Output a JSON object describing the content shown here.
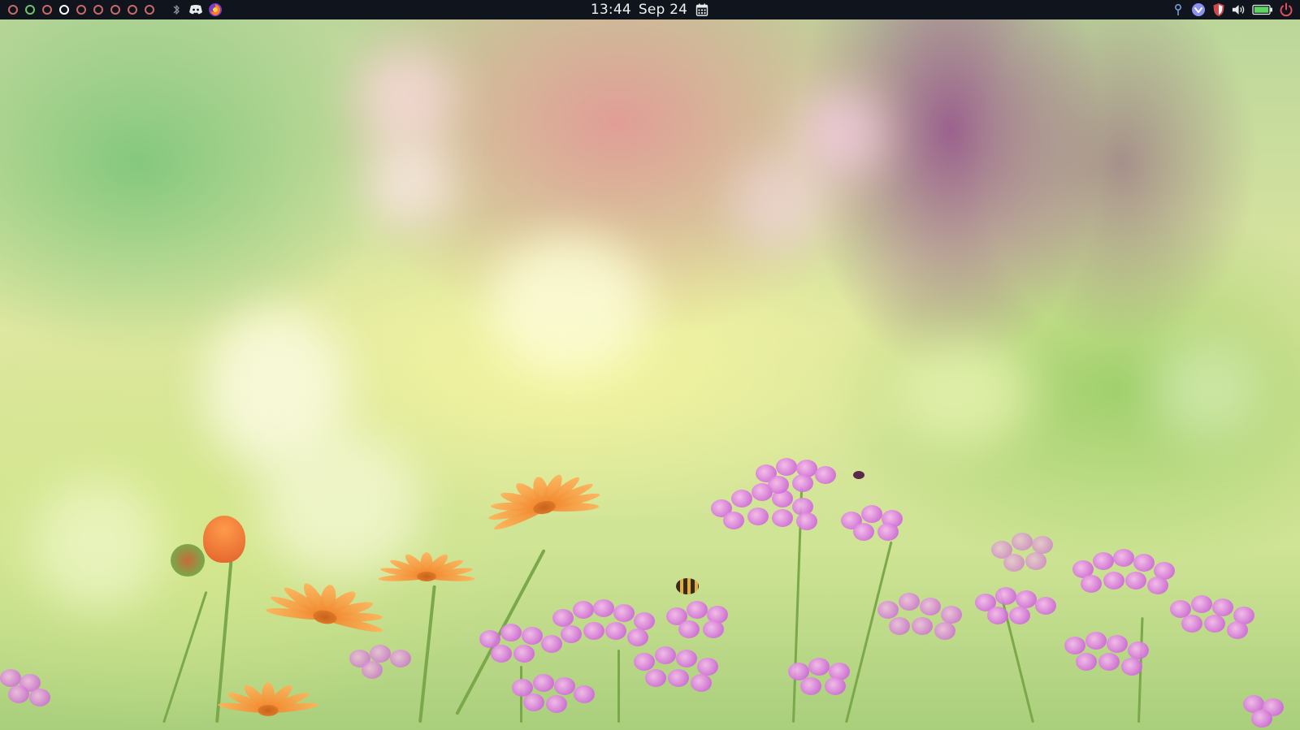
{
  "panel": {
    "workspaces": [
      {
        "state": "empty"
      },
      {
        "state": "occupied"
      },
      {
        "state": "empty"
      },
      {
        "state": "active"
      },
      {
        "state": "empty"
      },
      {
        "state": "empty"
      },
      {
        "state": "empty"
      },
      {
        "state": "empty"
      },
      {
        "state": "empty"
      }
    ],
    "left_tray": [
      {
        "icon": "bluetooth-icon"
      },
      {
        "icon": "discord-icon"
      },
      {
        "icon": "firefox-icon"
      }
    ],
    "clock": {
      "time": "13:44",
      "date": "Sep 24",
      "calendar_icon": "calendar-icon"
    },
    "right_tray": [
      {
        "icon": "network-icon"
      },
      {
        "icon": "vpn-icon"
      },
      {
        "icon": "shield-icon"
      },
      {
        "icon": "volume-icon"
      },
      {
        "icon": "battery-icon",
        "level": 1.0
      },
      {
        "icon": "power-icon"
      }
    ]
  },
  "colors": {
    "panel_bg": "#10151d",
    "workspace_empty": "#c86a6a",
    "workspace_occupied": "#6fc36f",
    "workspace_active": "#ffffff",
    "battery": "#5fd35f",
    "power": "#e0505a"
  },
  "wallpaper": {
    "description_icon": "flower-meadow-wallpaper"
  }
}
